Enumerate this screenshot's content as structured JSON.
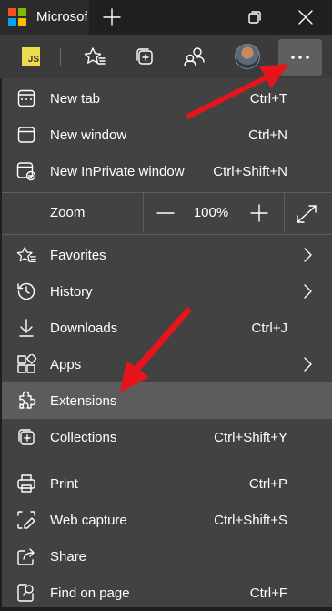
{
  "window": {
    "tab_title": "Microsoft Edge",
    "accent_colors": {
      "ms_red": "#f25022",
      "ms_green": "#7fba00",
      "ms_blue": "#00a4ef",
      "ms_yellow": "#ffb900"
    },
    "controls": [
      "new-tab-plus-icon",
      "restore-icon",
      "close-icon"
    ]
  },
  "toolbar": {
    "extension_badge": "JS",
    "icons": [
      "favorites-star-icon",
      "collections-icon",
      "profile-switch-icon",
      "avatar",
      "more-dots-icon"
    ]
  },
  "menu": {
    "items_top": [
      {
        "label": "New tab",
        "shortcut": "Ctrl+T",
        "icon": "new-tab-icon"
      },
      {
        "label": "New window",
        "shortcut": "Ctrl+N",
        "icon": "new-window-icon"
      },
      {
        "label": "New InPrivate window",
        "shortcut": "Ctrl+Shift+N",
        "icon": "inprivate-icon"
      }
    ],
    "zoom": {
      "label": "Zoom",
      "value": "100%",
      "minus": "zoom-out-icon",
      "plus": "zoom-in-icon",
      "fullscreen": "fullscreen-icon"
    },
    "items_mid": [
      {
        "label": "Favorites",
        "shortcut": "",
        "icon": "favorites-icon",
        "submenu": true
      },
      {
        "label": "History",
        "shortcut": "",
        "icon": "history-icon",
        "submenu": true
      },
      {
        "label": "Downloads",
        "shortcut": "Ctrl+J",
        "icon": "download-icon",
        "submenu": false
      },
      {
        "label": "Apps",
        "shortcut": "",
        "icon": "apps-icon",
        "submenu": true
      },
      {
        "label": "Extensions",
        "shortcut": "",
        "icon": "extensions-icon",
        "submenu": false
      },
      {
        "label": "Collections",
        "shortcut": "Ctrl+Shift+Y",
        "icon": "collections-icon",
        "submenu": false
      }
    ],
    "items_bottom": [
      {
        "label": "Print",
        "shortcut": "Ctrl+P",
        "icon": "print-icon"
      },
      {
        "label": "Web capture",
        "shortcut": "Ctrl+Shift+S",
        "icon": "web-capture-icon"
      },
      {
        "label": "Share",
        "shortcut": "",
        "icon": "share-icon"
      },
      {
        "label": "Find on page",
        "shortcut": "Ctrl+F",
        "icon": "find-icon"
      }
    ],
    "highlighted_item": "Extensions"
  },
  "annotations": {
    "arrow_color": "#e8141c"
  }
}
